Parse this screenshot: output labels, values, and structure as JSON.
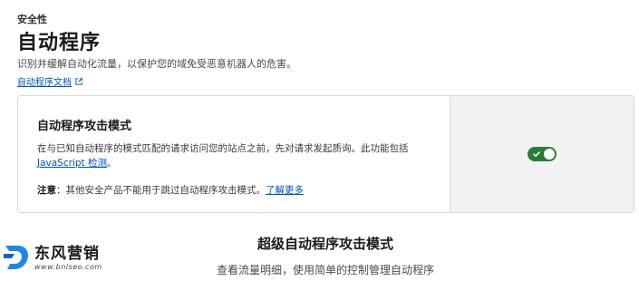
{
  "header": {
    "eyebrow": "安全性",
    "title": "自动程序",
    "subtitle": "识别并缓解自动化流量，以保护您的域免受恶意机器人的危害。",
    "doc_link": "自动程序文档"
  },
  "card": {
    "title": "自动程序攻击模式",
    "desc_text": "在与已知自动程序的模式匹配的请求访问您的站点之前，先对请求发起质询。此功能包括",
    "desc_link": "JavaScript 检测",
    "desc_end": "。",
    "note_label": "注意",
    "note_text": "：其他安全产品不能用于跳过自动程序攻击模式。",
    "note_link": "了解更多",
    "toggle_state": "on",
    "toggle_color": "#2c7a3a"
  },
  "super_section": {
    "title": "超级自动程序攻击模式",
    "subtitle": "查看流量明细，使用简单的控制管理自动程序"
  },
  "watermark": {
    "name": "东风营销",
    "url": "www.bnlseo.com"
  }
}
